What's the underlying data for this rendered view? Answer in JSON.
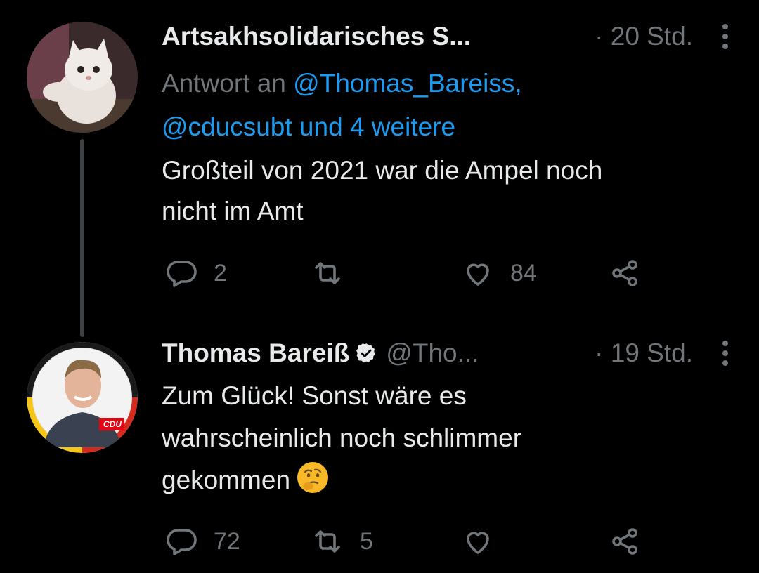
{
  "tweets": [
    {
      "author_name": "Artsakhsolidarisches S...",
      "time": "· 20 Std.",
      "reply_prefix": "Antwort an ",
      "reply_mentions_line1": "@Thomas_Bareiss,",
      "reply_mentions_line2": "@cducsubt und 4 weitere",
      "text_line1": "Großteil von 2021 war die Ampel noch",
      "text_line2": "nicht im Amt",
      "reply_count": "2",
      "retweet_count": "",
      "like_count": "84"
    },
    {
      "author_name": "Thomas Bareiß",
      "handle": "@Tho...",
      "time": "· 19 Std.",
      "verified": true,
      "text_line1": "Zum Glück! Sonst wäre es",
      "text_line2": "wahrscheinlich noch schlimmer",
      "text_line3": "gekommen",
      "emoji": "thinking-face",
      "avatar_badge": "CDU",
      "reply_count": "72",
      "retweet_count": "5",
      "like_count": ""
    }
  ],
  "colors": {
    "background": "#000000",
    "primary_text": "#e7e9ea",
    "secondary_text": "#71767b",
    "link": "#1d9bf0"
  },
  "icons": [
    "reply-icon",
    "retweet-icon",
    "like-icon",
    "share-icon",
    "more-icon",
    "verified-icon"
  ]
}
